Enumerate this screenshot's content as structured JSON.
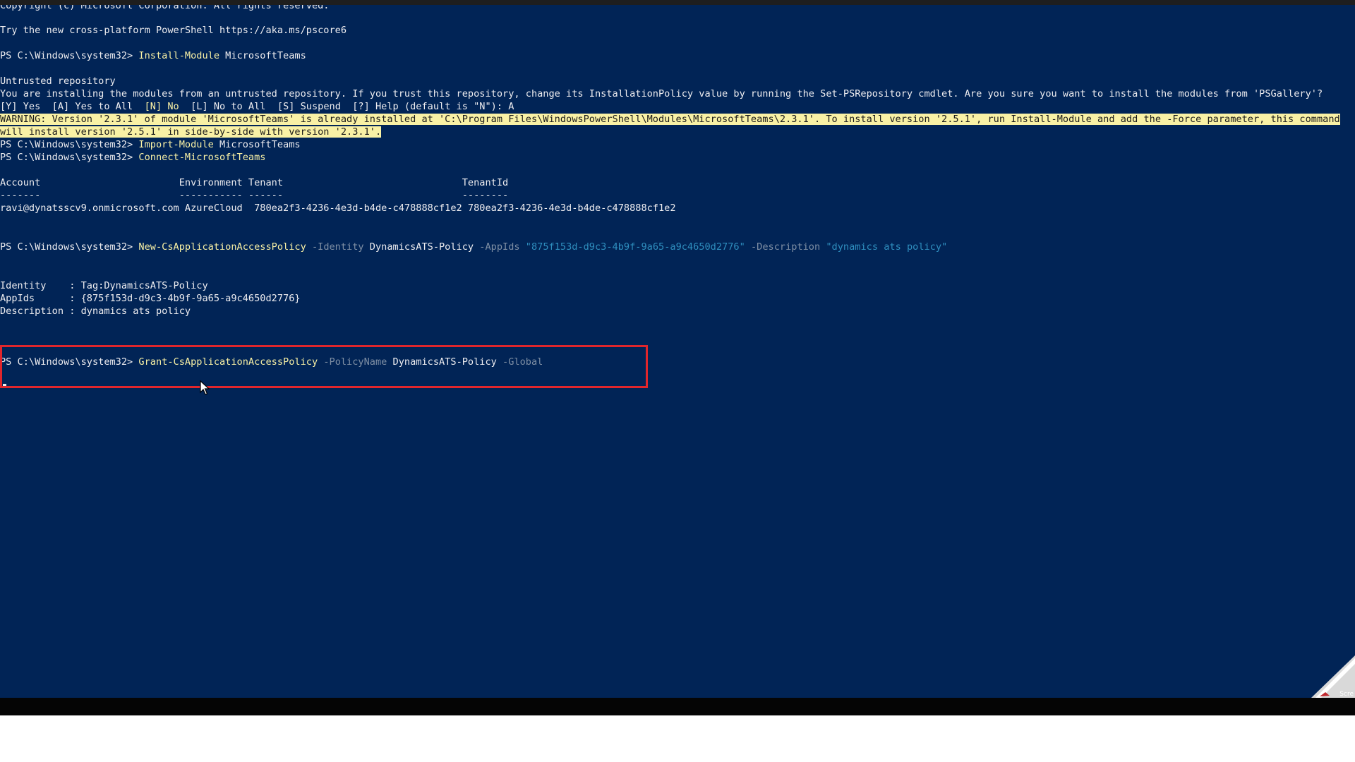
{
  "terminal": {
    "copyright": "Copyright (c) Microsoft Corporation. All rights reserved.",
    "try_new": "Try the new cross-platform PowerShell https://aka.ms/pscore6",
    "prompt": "PS C:\\Windows\\system32> ",
    "cmd1": {
      "name": "Install-Module",
      "args": " MicrosoftTeams"
    },
    "untrusted_title": "Untrusted repository",
    "untrusted_msg": "You are installing the modules from an untrusted repository. If you trust this repository, change its InstallationPolicy value by running the Set-PSRepository cmdlet. Are you sure you want to install the modules from 'PSGallery'?",
    "choices": {
      "yes": "[Y] Yes  [A] Yes to All  ",
      "no": "[N] No",
      "rest": "  [L] No to All  [S] Suspend  [?] Help (default is \"N\"): A"
    },
    "warning_line1": "WARNING: Version '2.3.1' of module 'MicrosoftTeams' is already installed at 'C:\\Program Files\\WindowsPowerShell\\Modules\\MicrosoftTeams\\2.3.1'. To install version '2.5.1', run Install-Module and add the -Force parameter, this command",
    "warning_line2": "will install version '2.5.1' in side-by-side with version '2.3.1'.",
    "cmd2": {
      "name": "Import-Module",
      "args": " MicrosoftTeams"
    },
    "cmd3": {
      "name": "Connect-MicrosoftTeams"
    },
    "table": {
      "header": "Account                        Environment Tenant                               TenantId",
      "divider": "-------                        ----------- ------                               --------",
      "row": "ravi@dynatsscv9.onmicrosoft.com AzureCloud  780ea2f3-4236-4e3d-b4de-c478888cf1e2 780ea2f3-4236-4e3d-b4de-c478888cf1e2"
    },
    "cmd4": {
      "name": "New-CsApplicationAccessPolicy",
      "p1": " -Identity",
      "v1": " DynamicsATS-Policy",
      "p2": " -AppIds",
      "v2": " \"875f153d-d9c3-4b9f-9a65-a9c4650d2776\"",
      "p3": " -Description",
      "v3": " \"dynamics ats policy\""
    },
    "result": {
      "identity": "Identity    : Tag:DynamicsATS-Policy",
      "appids": "AppIds      : {875f153d-d9c3-4b9f-9a65-a9c4650d2776}",
      "description": "Description : dynamics ats policy"
    },
    "cmd5": {
      "name": "Grant-CsApplicationAccessPolicy",
      "p1": " -PolicyName",
      "v1": " DynamicsATS-Policy",
      "p2": " -Global"
    }
  },
  "overlay": {
    "corner_label": "Scre"
  },
  "colors": {
    "console_bg": "#012456",
    "command": "#f9f1a5",
    "highlight": "#e0262c"
  }
}
